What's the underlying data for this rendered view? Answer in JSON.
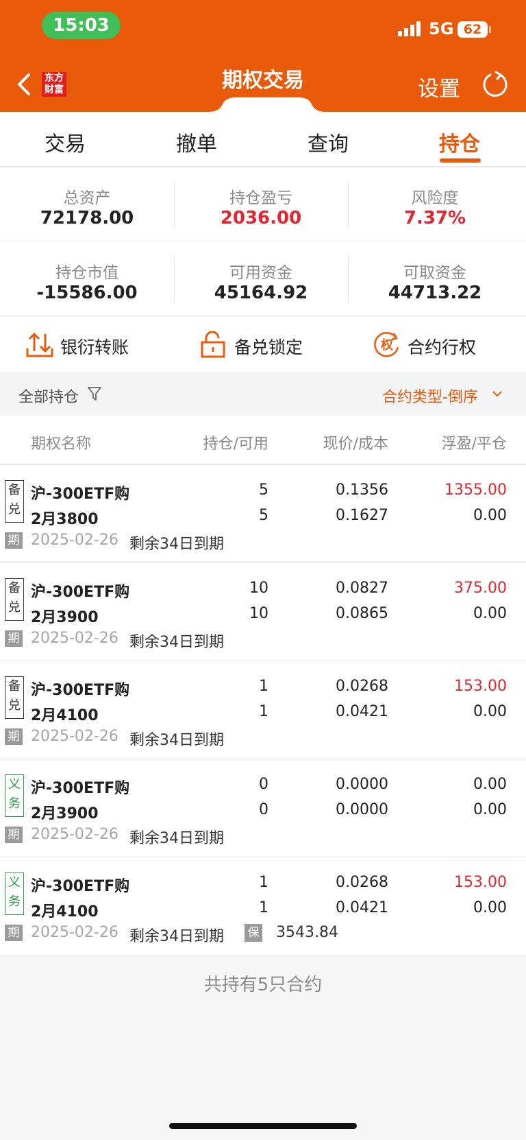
{
  "status_bar": {
    "time": "15:03",
    "network": "5G",
    "battery": "62"
  },
  "header": {
    "logo_line1": "东方",
    "logo_line2": "财富",
    "title": "期权交易",
    "settings_label": "设置"
  },
  "tabs": [
    {
      "label": "交易",
      "active": false
    },
    {
      "label": "撤单",
      "active": false
    },
    {
      "label": "查询",
      "active": false
    },
    {
      "label": "持仓",
      "active": true
    }
  ],
  "summary": {
    "row1": [
      {
        "label": "总资产",
        "value": "72178.00"
      },
      {
        "label": "持仓盈亏",
        "value": "2036.00"
      },
      {
        "label": "风险度",
        "value": "7.37%"
      }
    ],
    "row2": [
      {
        "label": "持仓市值",
        "value": "-15586.00"
      },
      {
        "label": "可用资金",
        "value": "45164.92"
      },
      {
        "label": "可取资金",
        "value": "44713.22"
      }
    ]
  },
  "actions": [
    {
      "label": "银衍转账",
      "icon": "bank-transfer-icon"
    },
    {
      "label": "备兑锁定",
      "icon": "unlock-icon"
    },
    {
      "label": "合约行权",
      "icon": "exercise-icon",
      "icon_text": "权"
    }
  ],
  "filter": {
    "label": "全部持仓",
    "sort_label": "合约类型-倒序"
  },
  "table": {
    "headers": [
      "期权名称",
      "持仓/可用",
      "现价/成本",
      "浮盈/平仓"
    ],
    "rows": [
      {
        "badge_top": "备",
        "badge_bottom": "兑",
        "type": "covered",
        "name": "沪-300ETF购",
        "contract": "2月3800",
        "position": "5",
        "available": "5",
        "price": "0.1356",
        "cost": "0.1627",
        "pnl": "1355.00",
        "close": "0.00",
        "period": "期",
        "date": "2025-02-26",
        "remaining": "剩余34日到期"
      },
      {
        "badge_top": "备",
        "badge_bottom": "兑",
        "type": "covered",
        "name": "沪-300ETF购",
        "contract": "2月3900",
        "position": "10",
        "available": "10",
        "price": "0.0827",
        "cost": "0.0865",
        "pnl": "375.00",
        "close": "0.00",
        "period": "期",
        "date": "2025-02-26",
        "remaining": "剩余34日到期"
      },
      {
        "badge_top": "备",
        "badge_bottom": "兑",
        "type": "covered",
        "name": "沪-300ETF购",
        "contract": "2月4100",
        "position": "1",
        "available": "1",
        "price": "0.0268",
        "cost": "0.0421",
        "pnl": "153.00",
        "close": "0.00",
        "period": "期",
        "date": "2025-02-26",
        "remaining": "剩余34日到期"
      },
      {
        "badge_top": "义",
        "badge_bottom": "务",
        "type": "obligation",
        "name": "沪-300ETF购",
        "contract": "2月3900",
        "position": "0",
        "available": "0",
        "price": "0.0000",
        "cost": "0.0000",
        "pnl": "0.00",
        "close": "0.00",
        "period": "期",
        "date": "2025-02-26",
        "remaining": "剩余34日到期"
      },
      {
        "badge_top": "义",
        "badge_bottom": "务",
        "type": "obligation",
        "name": "沪-300ETF购",
        "contract": "2月4100",
        "position": "1",
        "available": "1",
        "price": "0.0268",
        "cost": "0.0421",
        "pnl": "153.00",
        "close": "0.00",
        "period": "期",
        "date": "2025-02-26",
        "remaining": "剩余34日到期",
        "margin_label": "保",
        "margin": "3543.84"
      }
    ]
  },
  "footer": {
    "summary": "共持有5只合约"
  },
  "colors": {
    "brand": "#ea5a0b",
    "profit": "#e0262f",
    "obligation": "#2ea043"
  }
}
